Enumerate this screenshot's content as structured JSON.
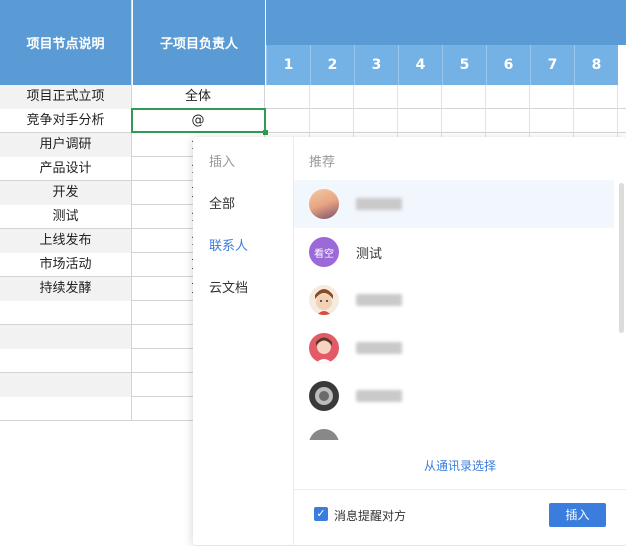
{
  "header": {
    "col1": "项目节点说明",
    "col2": "子项目负责人",
    "numbers": [
      "1",
      "2",
      "3",
      "4",
      "5",
      "6",
      "7",
      "8"
    ]
  },
  "rows": [
    {
      "name": "项目正式立项",
      "owner": "全体"
    },
    {
      "name": "竞争对手分析",
      "owner": "@"
    },
    {
      "name": "用户调研",
      "owner": "金"
    },
    {
      "name": "产品设计",
      "owner": "金"
    },
    {
      "name": "开发",
      "owner": "文"
    },
    {
      "name": "测试",
      "owner": "金"
    },
    {
      "name": "上线发布",
      "owner": "金"
    },
    {
      "name": "市场活动",
      "owner": "文"
    },
    {
      "name": "持续发酵",
      "owner": "文"
    }
  ],
  "popup": {
    "left_title": "插入",
    "nav": [
      "全部",
      "联系人",
      "云文档"
    ],
    "active_nav": "联系人",
    "right_title": "推荐",
    "contacts": [
      {
        "avatar_text": "",
        "avatar_color": "#e7a583"
      },
      {
        "avatar_text": "看空",
        "name": "测试",
        "avatar_color": "#9c6ad8"
      },
      {
        "avatar_text": "",
        "avatar_color": "#f0d9c4"
      },
      {
        "avatar_text": "",
        "avatar_color": "#e35b66"
      },
      {
        "avatar_text": "",
        "avatar_color": "#555555"
      }
    ],
    "address_book_link": "从通讯录选择",
    "notify_label": "消息提醒对方",
    "insert_button": "插入"
  },
  "colors": {
    "header_blue": "#5b9bd5",
    "header_light_blue": "#74b2e5",
    "accent": "#3b7ddd",
    "selection_green": "#2e9c55"
  }
}
